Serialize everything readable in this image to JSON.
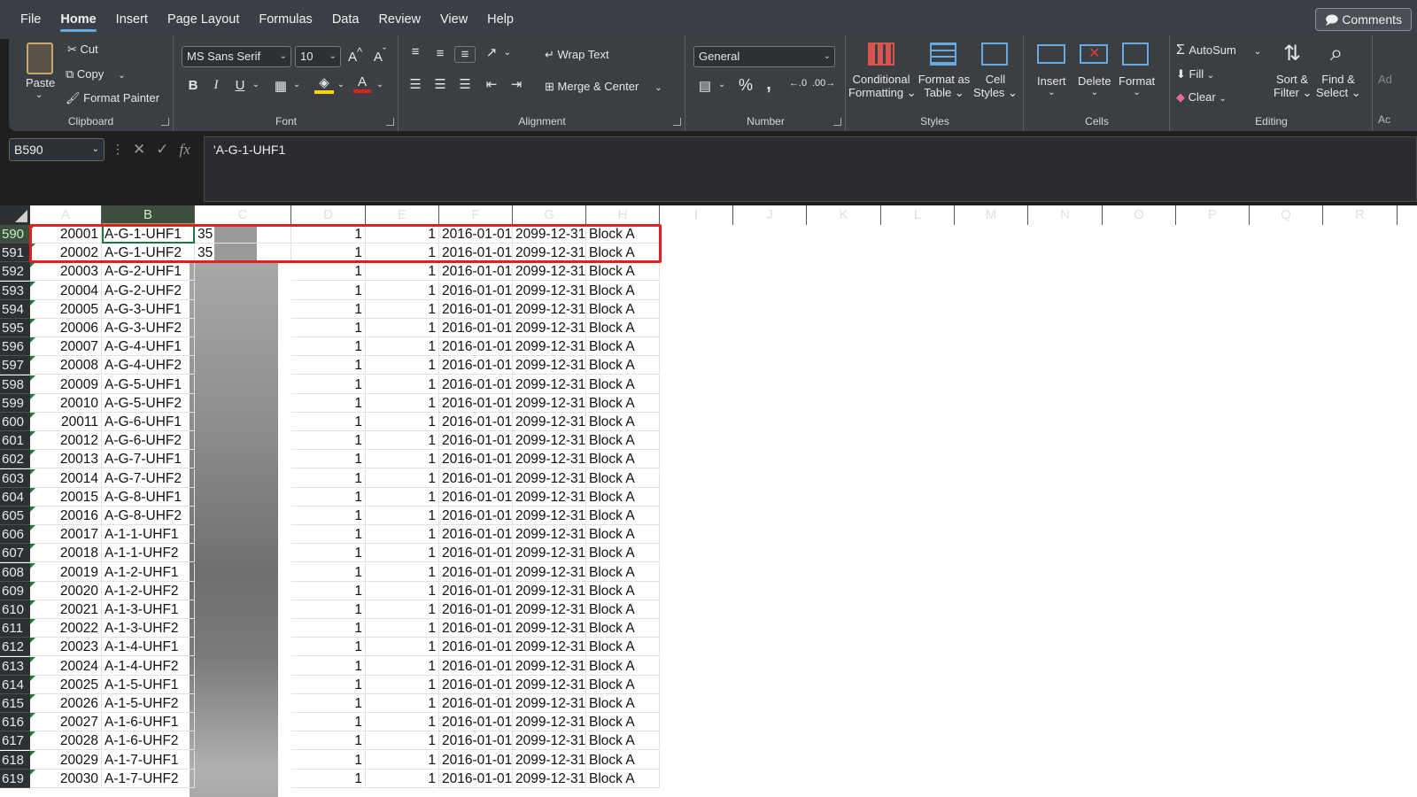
{
  "menu": [
    "File",
    "Home",
    "Insert",
    "Page Layout",
    "Formulas",
    "Data",
    "Review",
    "View",
    "Help"
  ],
  "menu_active": "Home",
  "comments_label": "Comments",
  "clipboard": {
    "paste": "Paste",
    "cut": "Cut",
    "copy": "Copy",
    "format_painter": "Format Painter",
    "label": "Clipboard"
  },
  "font": {
    "name": "MS Sans Serif",
    "size": "10",
    "label": "Font"
  },
  "alignment": {
    "wrap": "Wrap Text",
    "merge": "Merge & Center",
    "label": "Alignment"
  },
  "number": {
    "format": "General",
    "label": "Number"
  },
  "styles": {
    "cond1": "Conditional",
    "cond2": "Formatting",
    "fat1": "Format as",
    "fat2": "Table",
    "cs1": "Cell",
    "cs2": "Styles",
    "label": "Styles"
  },
  "cells": {
    "insert": "Insert",
    "delete": "Delete",
    "format": "Format",
    "label": "Cells"
  },
  "editing": {
    "autosum": "AutoSum",
    "fill": "Fill",
    "clear": "Clear",
    "sort1": "Sort &",
    "sort2": "Filter",
    "find1": "Find &",
    "find2": "Select",
    "label": "Editing"
  },
  "extra": {
    "ad": "Ad",
    "ac": "Ac"
  },
  "formula_bar": {
    "name_box": "B590",
    "content": "'A-G-1-UHF1",
    "fx": "fx"
  },
  "columns": [
    "A",
    "B",
    "C",
    "D",
    "E",
    "F",
    "G",
    "H",
    "I",
    "J",
    "K",
    "L",
    "M",
    "N",
    "O",
    "P",
    "Q",
    "R"
  ],
  "rows": [
    {
      "r": "590",
      "a": "20001",
      "b": "A-G-1-UHF1",
      "c": "35",
      "d": "1",
      "e": "1",
      "f": "2016-01-01",
      "g": "2099-12-31",
      "h": "Block A"
    },
    {
      "r": "591",
      "a": "20002",
      "b": "A-G-1-UHF2",
      "c": "35",
      "d": "1",
      "e": "1",
      "f": "2016-01-01",
      "g": "2099-12-31",
      "h": "Block A"
    },
    {
      "r": "592",
      "a": "20003",
      "b": "A-G-2-UHF1",
      "c": "",
      "d": "1",
      "e": "1",
      "f": "2016-01-01",
      "g": "2099-12-31",
      "h": "Block A"
    },
    {
      "r": "593",
      "a": "20004",
      "b": "A-G-2-UHF2",
      "c": "",
      "d": "1",
      "e": "1",
      "f": "2016-01-01",
      "g": "2099-12-31",
      "h": "Block A"
    },
    {
      "r": "594",
      "a": "20005",
      "b": "A-G-3-UHF1",
      "c": "",
      "d": "1",
      "e": "1",
      "f": "2016-01-01",
      "g": "2099-12-31",
      "h": "Block A"
    },
    {
      "r": "595",
      "a": "20006",
      "b": "A-G-3-UHF2",
      "c": "",
      "d": "1",
      "e": "1",
      "f": "2016-01-01",
      "g": "2099-12-31",
      "h": "Block A"
    },
    {
      "r": "596",
      "a": "20007",
      "b": "A-G-4-UHF1",
      "c": "",
      "d": "1",
      "e": "1",
      "f": "2016-01-01",
      "g": "2099-12-31",
      "h": "Block A"
    },
    {
      "r": "597",
      "a": "20008",
      "b": "A-G-4-UHF2",
      "c": "",
      "d": "1",
      "e": "1",
      "f": "2016-01-01",
      "g": "2099-12-31",
      "h": "Block A"
    },
    {
      "r": "598",
      "a": "20009",
      "b": "A-G-5-UHF1",
      "c": "",
      "d": "1",
      "e": "1",
      "f": "2016-01-01",
      "g": "2099-12-31",
      "h": "Block A"
    },
    {
      "r": "599",
      "a": "20010",
      "b": "A-G-5-UHF2",
      "c": "",
      "d": "1",
      "e": "1",
      "f": "2016-01-01",
      "g": "2099-12-31",
      "h": "Block A"
    },
    {
      "r": "600",
      "a": "20011",
      "b": "A-G-6-UHF1",
      "c": "",
      "d": "1",
      "e": "1",
      "f": "2016-01-01",
      "g": "2099-12-31",
      "h": "Block A"
    },
    {
      "r": "601",
      "a": "20012",
      "b": "A-G-6-UHF2",
      "c": "",
      "d": "1",
      "e": "1",
      "f": "2016-01-01",
      "g": "2099-12-31",
      "h": "Block A"
    },
    {
      "r": "602",
      "a": "20013",
      "b": "A-G-7-UHF1",
      "c": "",
      "d": "1",
      "e": "1",
      "f": "2016-01-01",
      "g": "2099-12-31",
      "h": "Block A"
    },
    {
      "r": "603",
      "a": "20014",
      "b": "A-G-7-UHF2",
      "c": "",
      "d": "1",
      "e": "1",
      "f": "2016-01-01",
      "g": "2099-12-31",
      "h": "Block A"
    },
    {
      "r": "604",
      "a": "20015",
      "b": "A-G-8-UHF1",
      "c": "",
      "d": "1",
      "e": "1",
      "f": "2016-01-01",
      "g": "2099-12-31",
      "h": "Block A"
    },
    {
      "r": "605",
      "a": "20016",
      "b": "A-G-8-UHF2",
      "c": "",
      "d": "1",
      "e": "1",
      "f": "2016-01-01",
      "g": "2099-12-31",
      "h": "Block A"
    },
    {
      "r": "606",
      "a": "20017",
      "b": "A-1-1-UHF1",
      "c": "",
      "d": "1",
      "e": "1",
      "f": "2016-01-01",
      "g": "2099-12-31",
      "h": "Block A"
    },
    {
      "r": "607",
      "a": "20018",
      "b": "A-1-1-UHF2",
      "c": "",
      "d": "1",
      "e": "1",
      "f": "2016-01-01",
      "g": "2099-12-31",
      "h": "Block A"
    },
    {
      "r": "608",
      "a": "20019",
      "b": "A-1-2-UHF1",
      "c": "",
      "d": "1",
      "e": "1",
      "f": "2016-01-01",
      "g": "2099-12-31",
      "h": "Block A"
    },
    {
      "r": "609",
      "a": "20020",
      "b": "A-1-2-UHF2",
      "c": "",
      "d": "1",
      "e": "1",
      "f": "2016-01-01",
      "g": "2099-12-31",
      "h": "Block A"
    },
    {
      "r": "610",
      "a": "20021",
      "b": "A-1-3-UHF1",
      "c": "",
      "d": "1",
      "e": "1",
      "f": "2016-01-01",
      "g": "2099-12-31",
      "h": "Block A"
    },
    {
      "r": "611",
      "a": "20022",
      "b": "A-1-3-UHF2",
      "c": "",
      "d": "1",
      "e": "1",
      "f": "2016-01-01",
      "g": "2099-12-31",
      "h": "Block A"
    },
    {
      "r": "612",
      "a": "20023",
      "b": "A-1-4-UHF1",
      "c": "",
      "d": "1",
      "e": "1",
      "f": "2016-01-01",
      "g": "2099-12-31",
      "h": "Block A"
    },
    {
      "r": "613",
      "a": "20024",
      "b": "A-1-4-UHF2",
      "c": "",
      "d": "1",
      "e": "1",
      "f": "2016-01-01",
      "g": "2099-12-31",
      "h": "Block A"
    },
    {
      "r": "614",
      "a": "20025",
      "b": "A-1-5-UHF1",
      "c": "",
      "d": "1",
      "e": "1",
      "f": "2016-01-01",
      "g": "2099-12-31",
      "h": "Block A"
    },
    {
      "r": "615",
      "a": "20026",
      "b": "A-1-5-UHF2",
      "c": "",
      "d": "1",
      "e": "1",
      "f": "2016-01-01",
      "g": "2099-12-31",
      "h": "Block A"
    },
    {
      "r": "616",
      "a": "20027",
      "b": "A-1-6-UHF1",
      "c": "",
      "d": "1",
      "e": "1",
      "f": "2016-01-01",
      "g": "2099-12-31",
      "h": "Block A"
    },
    {
      "r": "617",
      "a": "20028",
      "b": "A-1-6-UHF2",
      "c": "",
      "d": "1",
      "e": "1",
      "f": "2016-01-01",
      "g": "2099-12-31",
      "h": "Block A"
    },
    {
      "r": "618",
      "a": "20029",
      "b": "A-1-7-UHF1",
      "c": "",
      "d": "1",
      "e": "1",
      "f": "2016-01-01",
      "g": "2099-12-31",
      "h": "Block A"
    },
    {
      "r": "619",
      "a": "20030",
      "b": "A-1-7-UHF2",
      "c": "",
      "d": "1",
      "e": "1",
      "f": "2016-01-01",
      "g": "2099-12-31",
      "h": "Block A"
    }
  ],
  "colors": {
    "accent": "#217346",
    "highlight": "#e02020",
    "ribbon": "#3b3f44"
  }
}
